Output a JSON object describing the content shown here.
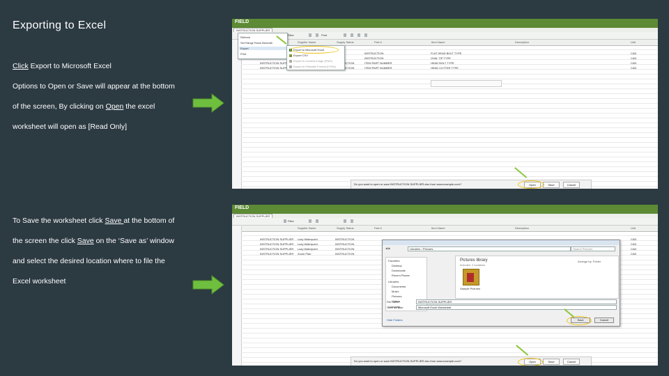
{
  "slide": {
    "title": "Exporting to Excel",
    "p1": {
      "click": "Click",
      "rest": " Export to Microsoft Excel"
    },
    "p2": "Options to Open or Save will appear at the bottom",
    "p3": {
      "a": "of the screen, By clicking on ",
      "open": "Open",
      "b": " the excel"
    },
    "p4": "worksheet will open as [Read Only]",
    "p5": {
      "a": "To Save the worksheet click ",
      "save": "Save ",
      "b": "at the bottom of"
    },
    "p6": {
      "a": "the screen the click ",
      "save": "Save",
      "b": " on the ‘Save as’ window"
    },
    "p7": "and select the desired location where to file the",
    "p8": "Excel worksheet"
  },
  "colors": {
    "background": "#2c3a42",
    "arrow": "#6fbf3f",
    "brand": "#5c8a35",
    "highlight": "#f0c419"
  },
  "shot1": {
    "brand": "FIELD",
    "tab": "INSTRUCTION SUPPLIER",
    "toolbar": [
      "Filter",
      "Print"
    ],
    "headers": [
      "Supplier Name",
      "Supply Status",
      "Part #",
      "Item Name",
      "Description",
      "Unit"
    ],
    "menu_left": [
      "Refresh",
      "Set Range Rows Beneath",
      "Export",
      "Print"
    ],
    "menu_right": [
      "Export to Microsoft Excel",
      "Export CSV",
      "Export to Content Image (PNG)",
      "Export to Printable Format (HTML)"
    ],
    "rows": [
      [
        "INSTRUCTION SUPPLIER",
        "Lazy Waterpoint",
        "INSTRUCTION",
        "ITEM PART NUMBER",
        "FLAT HEAD BOLT TYPE",
        "CAD"
      ],
      [
        "INSTRUCTION SUPPLIER",
        "Lazy Waterpoint",
        "INSTRUCTION",
        "ITEM PART NUMBER",
        "OVAL TIP TYPE",
        "CAD"
      ],
      [
        "INSTRUCTION SUPPLIER",
        "Lazy Waterpoint",
        "INSTRUCTION",
        "ITEM PART NUMBER",
        "HEAD BOLT TYPE",
        "CAD"
      ],
      [
        "INSTRUCTION SUPPLIER",
        "Zoom Plan",
        "INSTRUCTION",
        "ITEM PART NUMBER",
        "HEAD CUTTER TYPE",
        "CAD"
      ]
    ],
    "download_text": "Do you want to open or save INSTRUCTION SUPPLIER.xlsx from www.example.com?",
    "download_buttons": [
      "Open",
      "Save",
      "Cancel"
    ]
  },
  "shot2": {
    "brand": "FIELD",
    "tab": "INSTRUCTION SUPPLIER",
    "toolbar": [
      "Filter"
    ],
    "headers": [
      "Supplier Name",
      "Supply Status",
      "Part #",
      "Item Name",
      "Description",
      "Unit"
    ],
    "rows": [
      [
        "INSTRUCTION SUPPLIER",
        "Lazy Waterpoint",
        "INSTRUCTION",
        "ITEM PART NUMBER",
        "FLAT HEAD BOLT TYPE",
        "CAD"
      ],
      [
        "INSTRUCTION SUPPLIER",
        "Lazy Waterpoint",
        "INSTRUCTION",
        "ITEM PART NUMBER",
        "OVAL TIP TYPE",
        "CAD"
      ],
      [
        "INSTRUCTION SUPPLIER",
        "Lazy Waterpoint",
        "INSTRUCTION",
        "ITEM PART NUMBER",
        "HEAD BOLT TYPE",
        "CAD"
      ],
      [
        "INSTRUCTION SUPPLIER",
        "Zoom Plan",
        "INSTRUCTION",
        "ITEM PART NUMBER",
        "HEAD CUTTER TYPE",
        "CAD"
      ]
    ],
    "dialog": {
      "path": "Libraries › Pictures",
      "search": "Search Pictures",
      "tree": [
        "Favorites",
        "Desktop",
        "Downloads",
        "Recent Places",
        "Libraries",
        "Documents",
        "Music",
        "Pictures",
        "Videos",
        "Computer"
      ],
      "library_title": "Pictures library",
      "library_sub": "Includes: 2 locations",
      "arrange": "Arrange by: Folder",
      "folder": "Sample Pictures",
      "filename_label": "File name:",
      "filename": "INSTRUCTION SUPPLIER",
      "type_label": "Save as type:",
      "type": "Microsoft Excel Worksheet",
      "hide": "Hide Folders",
      "save": "Save",
      "cancel": "Cancel"
    },
    "download_text": "Do you want to open or save INSTRUCTION SUPPLIER.xlsx from www.example.com?",
    "download_buttons": [
      "Open",
      "Save",
      "Cancel"
    ]
  }
}
